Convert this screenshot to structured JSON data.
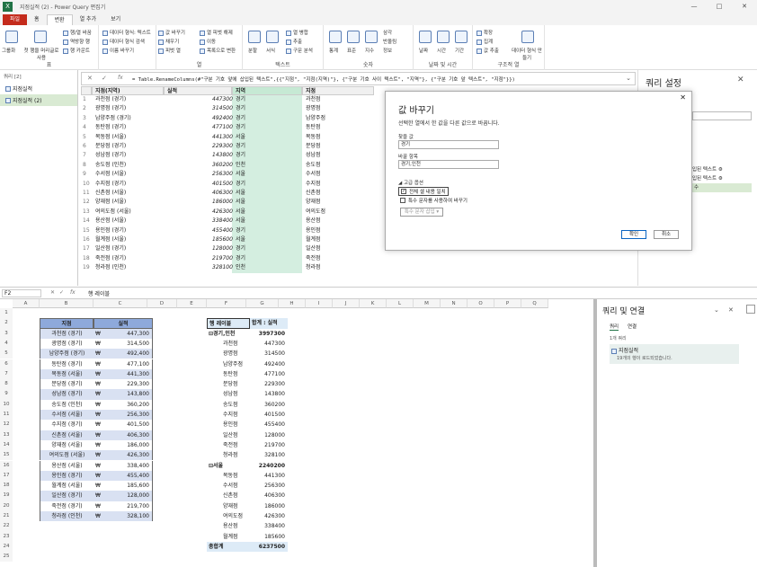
{
  "pq": {
    "title": "지점실적 (2) - Power Query 편집기",
    "window_controls": [
      "—",
      "□",
      "✕"
    ],
    "tabs": [
      "파일",
      "홈",
      "변환",
      "열 추가",
      "보기"
    ],
    "ribbon_groups": [
      {
        "label": "표",
        "buttons": [
          "그룹화",
          "첫 행을 머리글로 사용",
          "행/열 바꿈",
          "역방향 행",
          "행 카운트"
        ]
      },
      {
        "label": "",
        "buttons": [
          "데이터 형식: 텍스트",
          "데이터 형식 검색",
          "이름 바꾸기"
        ]
      },
      {
        "label": "",
        "buttons": [
          "값 바꾸기",
          "채우기",
          "피벗 열",
          "열 피벗 해제",
          "이동",
          "목록으로 변환"
        ]
      },
      {
        "label": "열",
        "buttons": []
      },
      {
        "label": "텍스트",
        "buttons": [
          "분할",
          "서식",
          "열 병합",
          "추출",
          "구문 분석"
        ]
      },
      {
        "label": "숫자",
        "buttons": [
          "통계",
          "표준",
          "지수",
          "삼각",
          "반올림",
          "정보"
        ]
      },
      {
        "label": "날짜 및 시간",
        "buttons": [
          "날짜",
          "시간",
          "기간"
        ]
      },
      {
        "label": "구조적 열",
        "buttons": [
          "확장",
          "집계",
          "값 추출",
          "데이터 형식 만들기"
        ]
      }
    ],
    "queries_header": "쿼리 [2]",
    "queries": [
      "지점실적",
      "지점실적 (2)"
    ],
    "formula": "= Table.RenameColumns(#\"구분 기호 앞에 삽입된 텍스트\",{{\"지점\", \"지점(지역)\"}, {\"구분 기호 사이 텍스트\", \"지역\"}, {\"구분 기호 앞 텍스트\", \"지점\"}})",
    "columns": [
      "지점(지역)",
      "실적",
      "지역",
      "지점"
    ],
    "rows": [
      [
        "과천점 (경기)",
        "447300",
        "경기",
        "과천점"
      ],
      [
        "광명점 (경기)",
        "314500",
        "경기",
        "광명점"
      ],
      [
        "남양주점 (경기)",
        "492400",
        "경기",
        "남양주점"
      ],
      [
        "동탄점 (경기)",
        "477100",
        "경기",
        "동탄점"
      ],
      [
        "목동점 (서울)",
        "441300",
        "서울",
        "목동점"
      ],
      [
        "분당점 (경기)",
        "229300",
        "경기",
        "분당점"
      ],
      [
        "성남점 (경기)",
        "143800",
        "경기",
        "성남점"
      ],
      [
        "송도점 (인천)",
        "360200",
        "인천",
        "송도점"
      ],
      [
        "수서점 (서울)",
        "256300",
        "서울",
        "수서점"
      ],
      [
        "수지점 (경기)",
        "401500",
        "경기",
        "수지점"
      ],
      [
        "신촌점 (서울)",
        "406300",
        "서울",
        "신촌점"
      ],
      [
        "양재점 (서울)",
        "186000",
        "서울",
        "양재점"
      ],
      [
        "여의도점 (서울)",
        "426300",
        "서울",
        "여의도점"
      ],
      [
        "용산점 (서울)",
        "338400",
        "서울",
        "용산점"
      ],
      [
        "용인점 (경기)",
        "455400",
        "경기",
        "용인점"
      ],
      [
        "월계점 (서울)",
        "185600",
        "서울",
        "월계점"
      ],
      [
        "일산점 (경기)",
        "128000",
        "경기",
        "일산점"
      ],
      [
        "죽전점 (경기)",
        "219700",
        "경기",
        "죽전점"
      ],
      [
        "청라점 (인천)",
        "328100",
        "인천",
        "청라점"
      ]
    ],
    "settings_title": "쿼리 설정",
    "steps": [
      "입된 텍스트",
      "입된 텍스트",
      "수"
    ]
  },
  "dialog": {
    "title": "값 바꾸기",
    "desc": "선택한 열에서 한 값을 다른 값으로 바꿉니다.",
    "find_label": "찾을 값",
    "find_value": "경기",
    "replace_label": "바꿀 항목",
    "replace_value": "경기,인천",
    "advanced": "◢ 고급 옵션",
    "match_entire": "전체 셀 내용 일치",
    "special_chars": "특수 문자를 사용하여 바꾸기",
    "insert_special": "특수 문자 삽입 ▾",
    "ok": "확인",
    "cancel": "취소"
  },
  "excel": {
    "name_box": "F2",
    "formula": "행 레이블",
    "col_letters": [
      "A",
      "B",
      "C",
      "D",
      "E",
      "F",
      "G",
      "H",
      "I",
      "J",
      "K",
      "L",
      "M",
      "N",
      "O",
      "P",
      "Q"
    ],
    "table_headers": [
      "지점",
      "실적"
    ],
    "table_rows": [
      [
        "과천점 (경기)",
        "₩",
        "447,300"
      ],
      [
        "광명점 (경기)",
        "₩",
        "314,500"
      ],
      [
        "남양주점 (경기)",
        "₩",
        "492,400"
      ],
      [
        "동탄점 (경기)",
        "₩",
        "477,100"
      ],
      [
        "목동점 (서울)",
        "₩",
        "441,300"
      ],
      [
        "분당점 (경기)",
        "₩",
        "229,300"
      ],
      [
        "성남점 (경기)",
        "₩",
        "143,800"
      ],
      [
        "송도점 (인천)",
        "₩",
        "360,200"
      ],
      [
        "수서점 (서울)",
        "₩",
        "256,300"
      ],
      [
        "수지점 (경기)",
        "₩",
        "401,500"
      ],
      [
        "신촌점 (서울)",
        "₩",
        "406,300"
      ],
      [
        "양재점 (서울)",
        "₩",
        "186,000"
      ],
      [
        "여의도점 (서울)",
        "₩",
        "426,300"
      ],
      [
        "용산점 (서울)",
        "₩",
        "338,400"
      ],
      [
        "용인점 (경기)",
        "₩",
        "455,400"
      ],
      [
        "월계점 (서울)",
        "₩",
        "185,600"
      ],
      [
        "일산점 (경기)",
        "₩",
        "128,000"
      ],
      [
        "죽전점 (경기)",
        "₩",
        "219,700"
      ],
      [
        "청라점 (인천)",
        "₩",
        "328,100"
      ]
    ],
    "pivot_headers": [
      "행 레이블",
      "합계 : 실적"
    ],
    "pivot_rows": [
      [
        "⊟경기,인천",
        "3997300",
        "group"
      ],
      [
        "과천점",
        "447300",
        ""
      ],
      [
        "광명점",
        "314500",
        ""
      ],
      [
        "남양주점",
        "492400",
        ""
      ],
      [
        "동탄점",
        "477100",
        ""
      ],
      [
        "분당점",
        "229300",
        ""
      ],
      [
        "성남점",
        "143800",
        ""
      ],
      [
        "송도점",
        "360200",
        ""
      ],
      [
        "수지점",
        "401500",
        ""
      ],
      [
        "용인점",
        "455400",
        ""
      ],
      [
        "일산점",
        "128000",
        ""
      ],
      [
        "죽전점",
        "219700",
        ""
      ],
      [
        "청라점",
        "328100",
        ""
      ],
      [
        "⊟서울",
        "2240200",
        "group"
      ],
      [
        "목동점",
        "441300",
        ""
      ],
      [
        "수서점",
        "256300",
        ""
      ],
      [
        "신촌점",
        "406300",
        ""
      ],
      [
        "양재점",
        "186000",
        ""
      ],
      [
        "여의도점",
        "426300",
        ""
      ],
      [
        "용산점",
        "338400",
        ""
      ],
      [
        "월계점",
        "185600",
        ""
      ],
      [
        "총합계",
        "6237500",
        "total"
      ]
    ],
    "pane_title": "쿼리 및 연결",
    "pane_tabs": [
      "쿼리",
      "연결"
    ],
    "pane_count": "1개 쿼리",
    "pane_query": "지점실적",
    "pane_query_status": "19개의 행이 로드되었습니다."
  }
}
